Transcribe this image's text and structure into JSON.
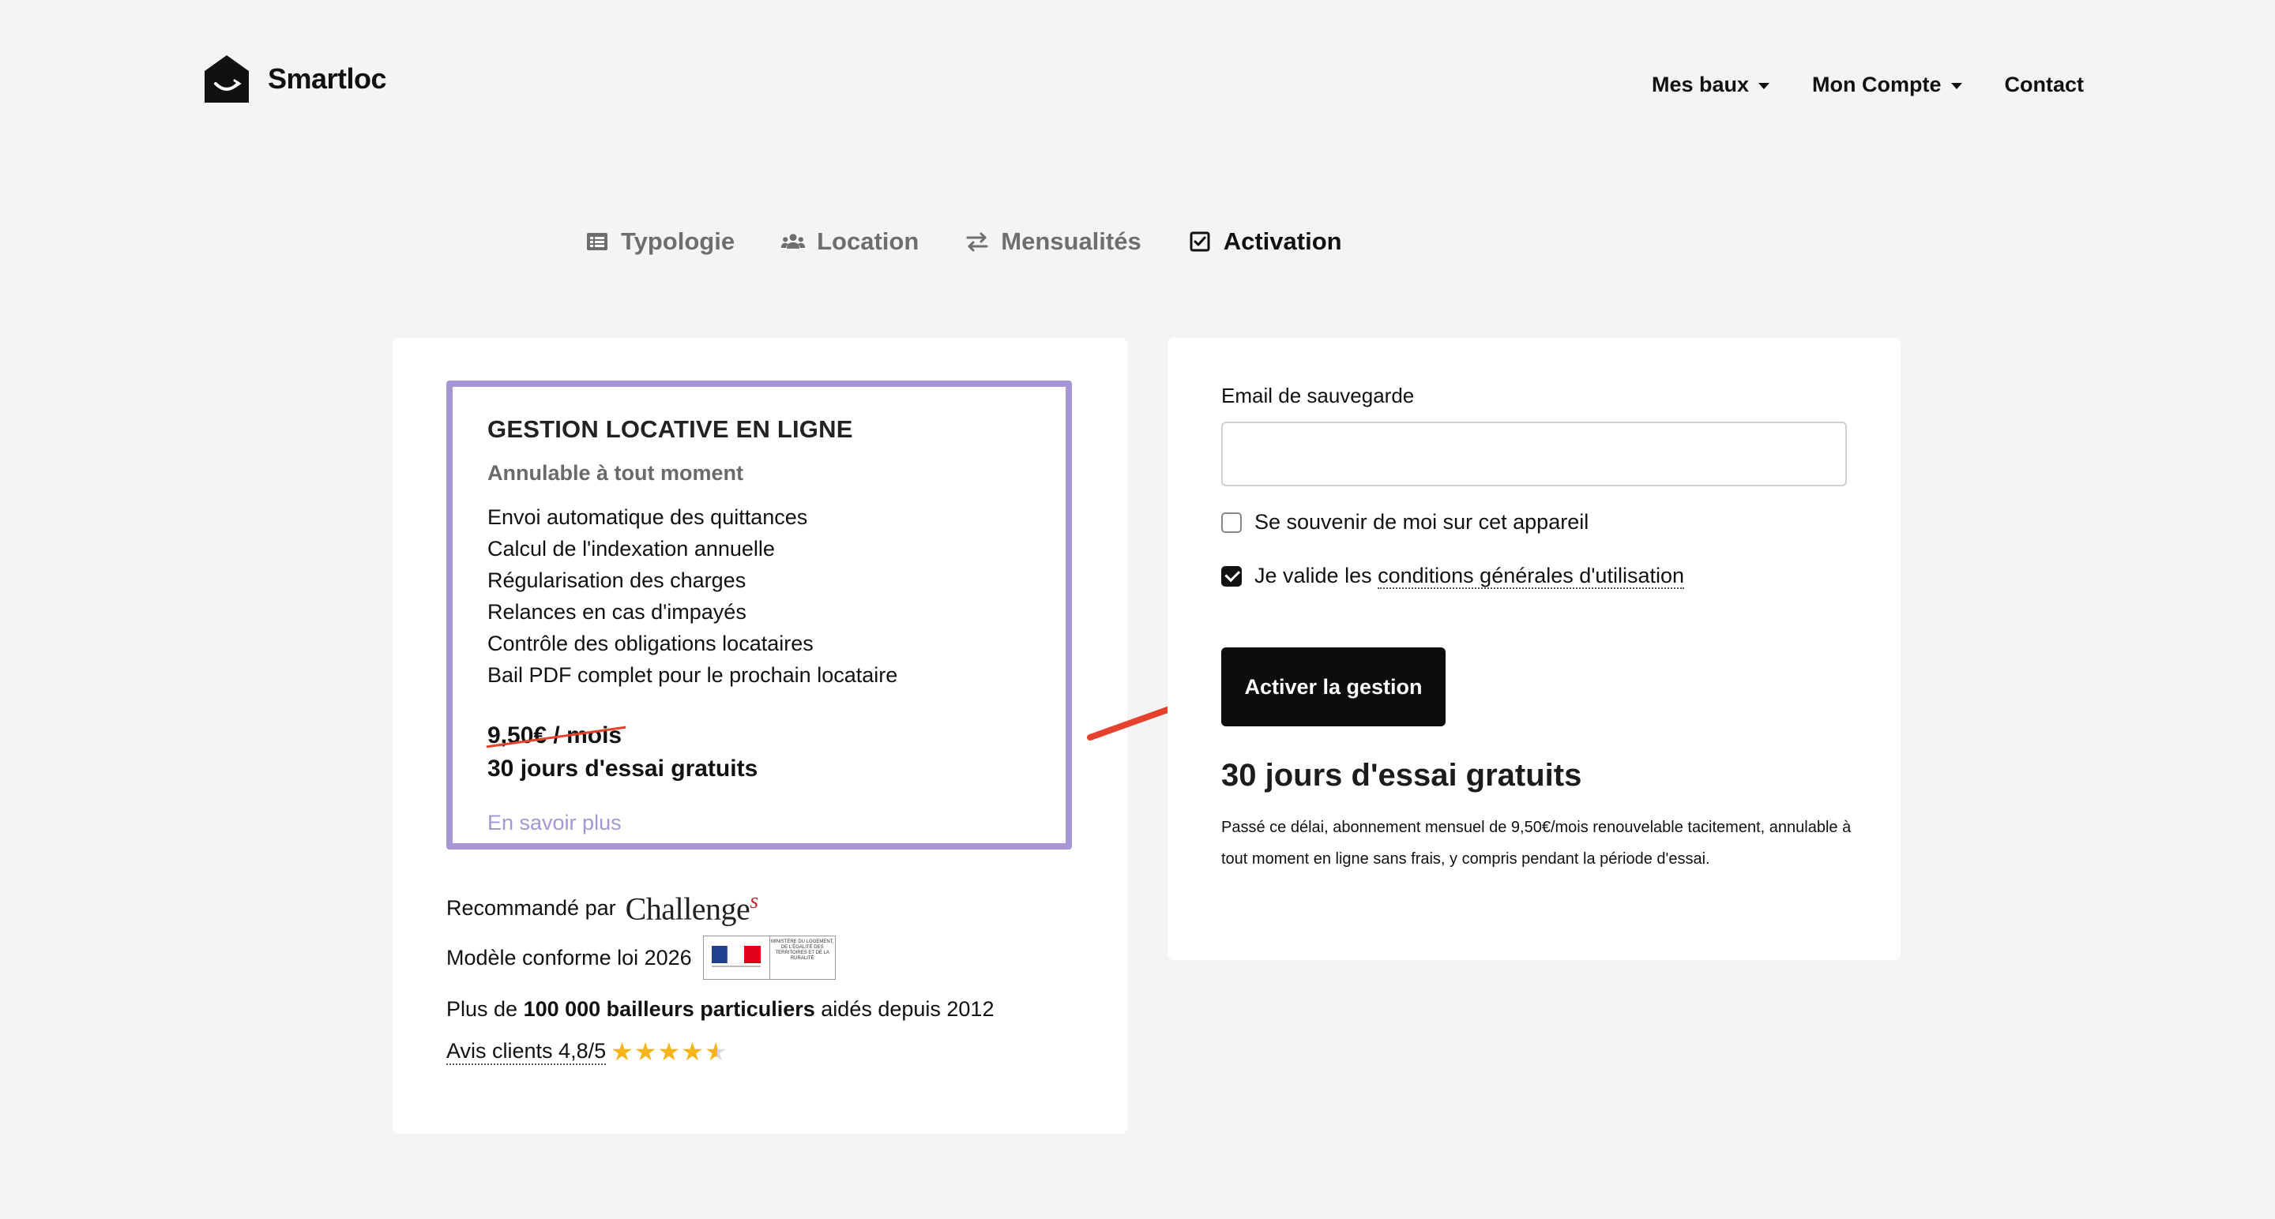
{
  "brand": {
    "name": "Smartloc"
  },
  "nav": {
    "items": [
      {
        "label": "Mes baux",
        "dropdown": true
      },
      {
        "label": "Mon Compte",
        "dropdown": true
      },
      {
        "label": "Contact",
        "dropdown": false
      }
    ]
  },
  "steps": [
    {
      "label": "Typologie",
      "icon": "list-icon",
      "active": false
    },
    {
      "label": "Location",
      "icon": "users-icon",
      "active": false
    },
    {
      "label": "Mensualités",
      "icon": "exchange-icon",
      "active": false
    },
    {
      "label": "Activation",
      "icon": "checkbox-icon",
      "active": true
    }
  ],
  "plan": {
    "title": "GESTION LOCATIVE EN LIGNE",
    "subtitle": "Annulable à tout moment",
    "features": [
      "Envoi automatique des quittances",
      "Calcul de l'indexation annuelle",
      "Régularisation des charges",
      "Relances en cas d'impayés",
      "Contrôle des obligations locataires",
      "Bail PDF complet pour le prochain locataire"
    ],
    "old_price": "9,50€ / mois",
    "trial": "30 jours d'essai gratuits",
    "learn_more": "En savoir plus"
  },
  "trust": {
    "recommended_prefix": "Recommandé par",
    "challenges_main": "Challenge",
    "challenges_s": "s",
    "conform": "Modèle conforme loi 2026",
    "gov_text": "MINISTÈRE DU LOGEMENT, DE L'ÉGALITÉ DES TERRITOIRES ET DE LA RURALITÉ",
    "bailleurs_prefix": "Plus de ",
    "bailleurs_bold": "100 000 bailleurs particuliers",
    "bailleurs_suffix": " aidés depuis 2012",
    "rating_label": "Avis clients 4,8/5",
    "rating": 4.8,
    "rating_max": 5
  },
  "form": {
    "email_label": "Email de sauvegarde",
    "email_value": "",
    "email_placeholder": "",
    "remember_label": "Se souvenir de moi sur cet appareil",
    "remember_checked": false,
    "cgu_prefix": "Je valide les ",
    "cgu_link": "conditions générales d'utilisation",
    "cgu_checked": true,
    "submit_label": "Activer la gestion",
    "trial_title": "30 jours d'essai gratuits",
    "notice": "Passé ce délai, abonnement mensuel de 9,50€/mois renouvelable tacitement, annulable à tout moment en ligne sans frais, y compris pendant la période d'essai."
  },
  "colors": {
    "accent_purple": "#a796d6",
    "strike_red": "#e5412d",
    "star_gold": "#f4b41a",
    "button_black": "#0d0d0d"
  }
}
